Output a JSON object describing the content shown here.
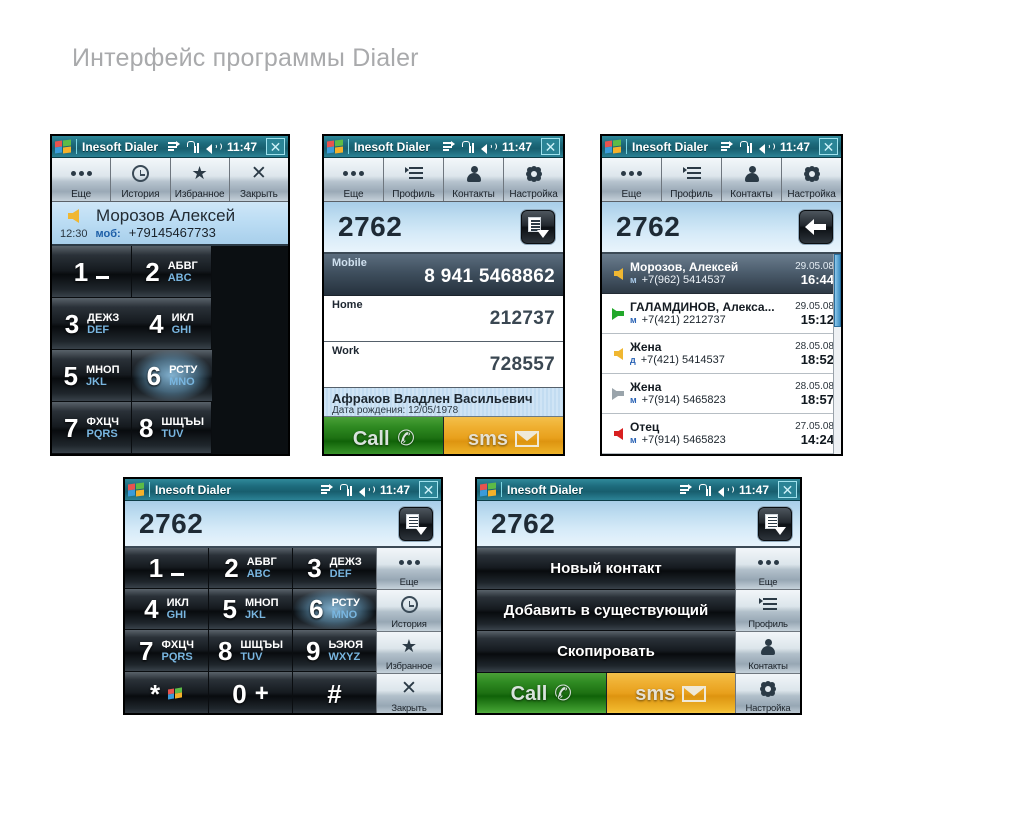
{
  "page": {
    "title": "Интерфейс программы Dialer"
  },
  "titlebar": {
    "app_name": "Inesoft Dialer",
    "time": "11:47",
    "close_label": "✕",
    "icons": [
      "connection-icon",
      "signal-icon",
      "speaker-icon"
    ]
  },
  "colors": {
    "titlebar_teal": "#1d6b7c",
    "accent_blue": "#79b6e0",
    "call_green": "#1d7012",
    "sms_orange": "#e8a01c",
    "highlight_blue": "#96cdf0",
    "incoming_arrow": "#f0b731",
    "outgoing_arrow": "#22a82a",
    "missed_arrow": "#d81f1f",
    "gray_arrow": "#9aa4ab"
  },
  "toolbar_main": {
    "items": [
      {
        "label": "Еще",
        "icon": "dots-icon"
      },
      {
        "label": "История",
        "icon": "clock-icon"
      },
      {
        "label": "Избранное",
        "icon": "star-icon"
      },
      {
        "label": "Закрыть",
        "icon": "close-x-icon"
      }
    ]
  },
  "toolbar_alt": {
    "items": [
      {
        "label": "Еще",
        "icon": "dots-icon"
      },
      {
        "label": "Профиль",
        "icon": "list-icon"
      },
      {
        "label": "Контакты",
        "icon": "person-icon"
      },
      {
        "label": "Настройка",
        "icon": "gear-icon"
      }
    ]
  },
  "keypad": {
    "keys": [
      {
        "digit": "1",
        "ru": "",
        "en": "",
        "extra": "space-underscore"
      },
      {
        "digit": "2",
        "ru": "АБВГ",
        "en": "ABC"
      },
      {
        "digit": "3",
        "ru": "ДЕЖЗ",
        "en": "DEF"
      },
      {
        "digit": "4",
        "ru": "ИКЛ",
        "en": "GHI"
      },
      {
        "digit": "5",
        "ru": "МНОП",
        "en": "JKL"
      },
      {
        "digit": "6",
        "ru": "РСТУ",
        "en": "MNO",
        "highlighted": true
      },
      {
        "digit": "7",
        "ru": "ФХЦЧ",
        "en": "PQRS"
      },
      {
        "digit": "8",
        "ru": "ШЩЪЫ",
        "en": "TUV"
      },
      {
        "digit": "9",
        "ru": "ЬЭЮЯ",
        "en": "WXYZ"
      },
      {
        "digit": "*",
        "ru": "",
        "en": "",
        "extra": "windows-flag"
      },
      {
        "digit": "0",
        "ru": "",
        "en": "",
        "extra": "plus"
      },
      {
        "digit": "#",
        "ru": "",
        "en": ""
      }
    ]
  },
  "phone1": {
    "call_info": {
      "direction": "incoming",
      "name": "Морозов Алексей",
      "time": "12:30",
      "number_type": "моб:",
      "number": "+79145467733"
    }
  },
  "phone2": {
    "number_display": {
      "value": "2762",
      "button_icon": "dropdown-list-icon"
    },
    "details": [
      {
        "label": "Mobile",
        "value": "8 941 5468862",
        "selected": true
      },
      {
        "label": "Home",
        "value": "212737",
        "selected": false
      },
      {
        "label": "Work",
        "value": "728557",
        "selected": false
      }
    ],
    "footer": {
      "name": "Афраков Владлен Васильевич",
      "birthday": "Дата рождения: 12/05/1978"
    },
    "actions": [
      {
        "label": "Call",
        "icon": "phone-icon"
      },
      {
        "label": "sms",
        "icon": "envelope-icon"
      }
    ]
  },
  "phone3": {
    "number_display": {
      "value": "2762",
      "button_icon": "back-arrow-icon"
    },
    "history": [
      {
        "direction": "incoming",
        "name": "Морозов, Алексей",
        "type": "м",
        "number": "+7(962) 5414537",
        "date": "29.05.08",
        "time": "16:44",
        "selected": true
      },
      {
        "direction": "outgoing",
        "name": "ГАЛАМДИНОВ, Алекса...",
        "type": "м",
        "number": "+7(421) 2212737",
        "date": "29.05.08",
        "time": "15:12",
        "selected": false
      },
      {
        "direction": "incoming",
        "name": "Жена",
        "type": "д",
        "number": "+7(421) 5414537",
        "date": "28.05.08",
        "time": "18:52",
        "selected": false
      },
      {
        "direction": "outgoing-gray",
        "name": "Жена",
        "type": "м",
        "number": "+7(914) 5465823",
        "date": "28.05.08",
        "time": "18:57",
        "selected": false
      },
      {
        "direction": "missed",
        "name": "Отец",
        "type": "м",
        "number": "+7(914) 5465823",
        "date": "27.05.08",
        "time": "14:24",
        "selected": false
      }
    ]
  },
  "phone4": {
    "number_display": {
      "value": "2762",
      "button_icon": "dropdown-list-icon"
    }
  },
  "phone5": {
    "number_display": {
      "value": "2762",
      "button_icon": "dropdown-list-icon"
    },
    "menu": [
      {
        "label": "Новый контакт"
      },
      {
        "label": "Добавить в существующий"
      },
      {
        "label": "Скопировать"
      }
    ],
    "actions": [
      {
        "label": "Call",
        "icon": "phone-icon"
      },
      {
        "label": "sms",
        "icon": "envelope-icon"
      }
    ]
  }
}
